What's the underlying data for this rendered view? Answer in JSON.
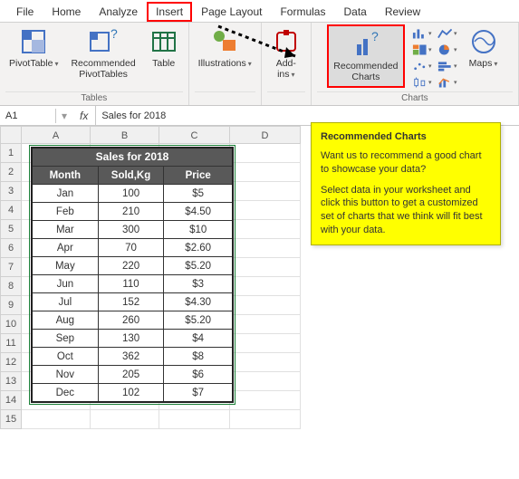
{
  "tabs": [
    "File",
    "Home",
    "Analyze",
    "Insert",
    "Page Layout",
    "Formulas",
    "Data",
    "Review"
  ],
  "active_tab": "Insert",
  "ribbon": {
    "tables": {
      "pivot": "PivotTable",
      "rec_pivot": "Recommended\nPivotTables",
      "table": "Table",
      "group": "Tables"
    },
    "illus": {
      "label": "Illustrations"
    },
    "addins": {
      "label": "Add-\nins"
    },
    "charts": {
      "rec": "Recommended\nCharts",
      "maps": "Maps",
      "group": "Charts"
    }
  },
  "formula_bar": {
    "name": "A1",
    "value": "Sales for 2018"
  },
  "columns": [
    "A",
    "B",
    "C",
    "D"
  ],
  "rows": [
    1,
    2,
    3,
    4,
    5,
    6,
    7,
    8,
    9,
    10,
    11,
    12,
    13,
    14,
    15
  ],
  "table": {
    "title": "Sales for 2018",
    "headers": [
      "Month",
      "Sold,Kg",
      "Price"
    ],
    "rows": [
      [
        "Jan",
        "100",
        "$5"
      ],
      [
        "Feb",
        "210",
        "$4.50"
      ],
      [
        "Mar",
        "300",
        "$10"
      ],
      [
        "Apr",
        "70",
        "$2.60"
      ],
      [
        "May",
        "220",
        "$5.20"
      ],
      [
        "Jun",
        "110",
        "$3"
      ],
      [
        "Jul",
        "152",
        "$4.30"
      ],
      [
        "Aug",
        "260",
        "$5.20"
      ],
      [
        "Sep",
        "130",
        "$4"
      ],
      [
        "Oct",
        "362",
        "$8"
      ],
      [
        "Nov",
        "205",
        "$6"
      ],
      [
        "Dec",
        "102",
        "$7"
      ]
    ]
  },
  "tooltip": {
    "title": "Recommended Charts",
    "p1": "Want us to recommend a good chart to showcase your data?",
    "p2": "Select data in your worksheet and click this button to get a customized set of charts that we think will fit best with your data."
  },
  "chart_data": {
    "type": "table",
    "title": "Sales for 2018",
    "columns": [
      "Month",
      "Sold,Kg",
      "Price"
    ],
    "rows": [
      {
        "Month": "Jan",
        "Sold,Kg": 100,
        "Price": 5.0
      },
      {
        "Month": "Feb",
        "Sold,Kg": 210,
        "Price": 4.5
      },
      {
        "Month": "Mar",
        "Sold,Kg": 300,
        "Price": 10.0
      },
      {
        "Month": "Apr",
        "Sold,Kg": 70,
        "Price": 2.6
      },
      {
        "Month": "May",
        "Sold,Kg": 220,
        "Price": 5.2
      },
      {
        "Month": "Jun",
        "Sold,Kg": 110,
        "Price": 3.0
      },
      {
        "Month": "Jul",
        "Sold,Kg": 152,
        "Price": 4.3
      },
      {
        "Month": "Aug",
        "Sold,Kg": 260,
        "Price": 5.2
      },
      {
        "Month": "Sep",
        "Sold,Kg": 130,
        "Price": 4.0
      },
      {
        "Month": "Oct",
        "Sold,Kg": 362,
        "Price": 8.0
      },
      {
        "Month": "Nov",
        "Sold,Kg": 205,
        "Price": 6.0
      },
      {
        "Month": "Dec",
        "Sold,Kg": 102,
        "Price": 7.0
      }
    ]
  }
}
